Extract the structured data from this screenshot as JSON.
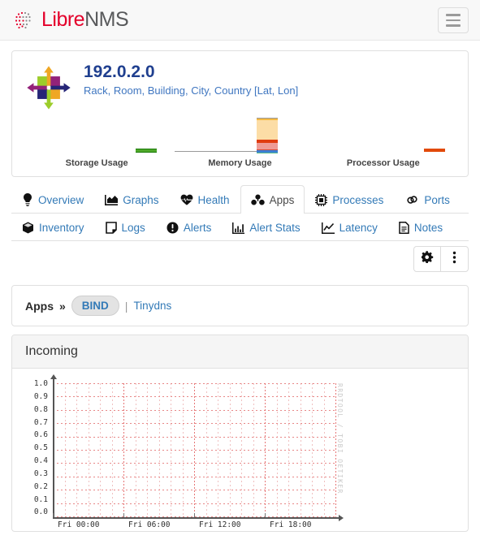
{
  "navbar": {
    "brand_libre": "Libre",
    "brand_nms": "NMS",
    "menu_icon": "hamburger-icon"
  },
  "device": {
    "os_logo": "centos-logo",
    "hostname": "192.0.2.0",
    "location": "Rack, Room, Building, City, Country [Lat, Lon]",
    "minigraphs": [
      {
        "label": "Storage Usage",
        "key": "storage"
      },
      {
        "label": "Memory Usage",
        "key": "memory"
      },
      {
        "label": "Processor Usage",
        "key": "processor"
      }
    ]
  },
  "tabs": {
    "row1": [
      {
        "label": "Overview",
        "icon": "lightbulb-icon",
        "active": false
      },
      {
        "label": "Graphs",
        "icon": "area-chart-icon",
        "active": false
      },
      {
        "label": "Health",
        "icon": "heartbeat-icon",
        "active": false
      },
      {
        "label": "Apps",
        "icon": "apps-cubes-icon",
        "active": true
      },
      {
        "label": "Processes",
        "icon": "microchip-icon",
        "active": false
      },
      {
        "label": "Ports",
        "icon": "link-chain-icon",
        "active": false
      }
    ],
    "row2": [
      {
        "label": "Inventory",
        "icon": "cube-icon",
        "active": false
      },
      {
        "label": "Logs",
        "icon": "note-icon",
        "active": false
      },
      {
        "label": "Alerts",
        "icon": "exclamation-circle-icon",
        "active": false
      },
      {
        "label": "Alert Stats",
        "icon": "bar-chart-icon",
        "active": false
      },
      {
        "label": "Latency",
        "icon": "line-chart-icon",
        "active": false
      },
      {
        "label": "Notes",
        "icon": "document-icon",
        "active": false
      }
    ]
  },
  "toolbar": {
    "settings_icon": "gear-icon",
    "more_icon": "vertical-ellipsis-icon"
  },
  "apps_bar": {
    "label": "Apps",
    "chevron": "»",
    "selected_app": "BIND",
    "divider": "|",
    "other_app": "Tinydns"
  },
  "graph": {
    "title": "Incoming",
    "watermark": "RRDTOOL / TOBI OETIKER"
  },
  "chart_data": {
    "type": "line",
    "title": "Incoming",
    "xlabel": "",
    "ylabel": "",
    "ylim": [
      0.0,
      1.0
    ],
    "ytick_labels": [
      "1.0",
      "0.9",
      "0.8",
      "0.7",
      "0.6",
      "0.5",
      "0.4",
      "0.3",
      "0.2",
      "0.1",
      "0.0"
    ],
    "ytick_values": [
      1.0,
      0.9,
      0.8,
      0.7,
      0.6,
      0.5,
      0.4,
      0.3,
      0.2,
      0.1,
      0.0
    ],
    "xtick_labels": [
      "Fri 00:00",
      "Fri 06:00",
      "Fri 12:00",
      "Fri 18:00"
    ],
    "xtick_positions": [
      0,
      0.25,
      0.5,
      0.75
    ],
    "grid": true,
    "grid_color": "#e26969",
    "legend": [],
    "series": [
      {
        "name": "Incoming",
        "values": []
      }
    ],
    "note": "No data plotted — empty RRD graph grid"
  },
  "colors": {
    "brand_red": "#e4002b",
    "brand_gray": "#58595b",
    "link_blue": "#337ab7",
    "title_blue": "#1f3f8f",
    "grid_red": "#e26969",
    "storage_green": "#4ea82a",
    "processor_orange": "#e24a0a",
    "memory_peach": "#fcdda6"
  }
}
